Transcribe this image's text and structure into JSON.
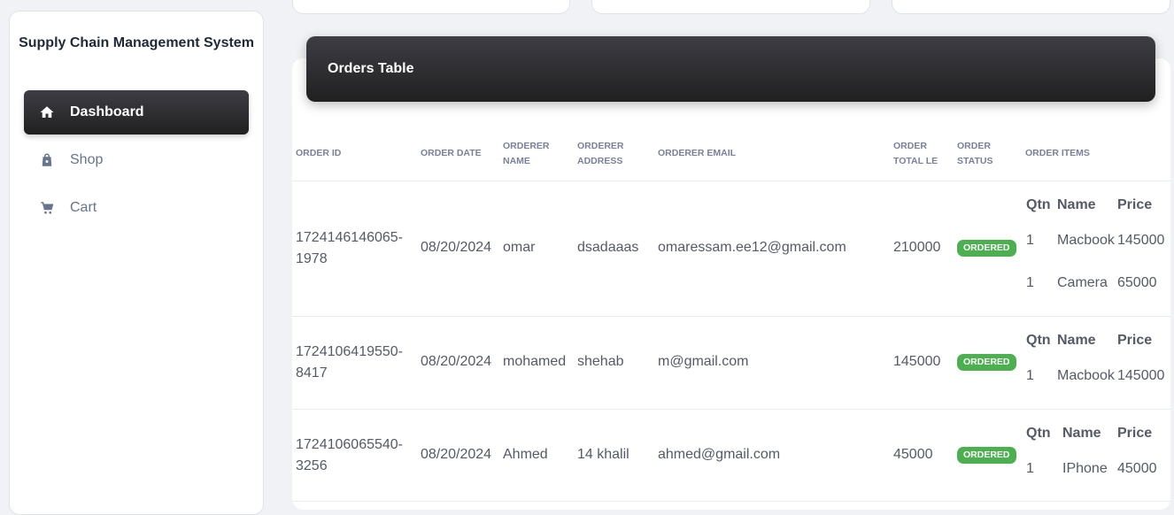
{
  "brand": {
    "title": "Supply Chain Management System"
  },
  "sidebar": {
    "items": [
      {
        "label": "Dashboard",
        "icon": "home-icon",
        "active": true
      },
      {
        "label": "Shop",
        "icon": "shopping-bag-icon",
        "active": false
      },
      {
        "label": "Cart",
        "icon": "cart-icon",
        "active": false
      }
    ]
  },
  "orders_table": {
    "title": "Orders Table",
    "columns": [
      "ORDER ID",
      "ORDER DATE",
      "ORDERER NAME",
      "ORDERER ADDRESS",
      "ORDERER EMAIL",
      "ORDER TOTAL LE",
      "ORDER STATUS",
      "ORDER ITEMS"
    ],
    "items_columns": [
      "Qtn",
      "Name",
      "Price"
    ],
    "rows": [
      {
        "order_id": "1724146146065-1978",
        "order_date": "08/20/2024",
        "name": "omar",
        "address": "dsadaaas",
        "email": "omaressam.ee12@gmail.com",
        "total": "210000",
        "status": "ORDERED",
        "items": [
          {
            "qtn": "1",
            "name": "Macbook",
            "price": "145000"
          },
          {
            "qtn": "1",
            "name": "Camera",
            "price": "65000"
          }
        ]
      },
      {
        "order_id": "1724106419550-8417",
        "order_date": "08/20/2024",
        "name": "mohamed",
        "address": "shehab",
        "email": "m@gmail.com",
        "total": "145000",
        "status": "ORDERED",
        "items": [
          {
            "qtn": "1",
            "name": "Macbook",
            "price": "145000"
          }
        ]
      },
      {
        "order_id": "1724106065540-3256",
        "order_date": "08/20/2024",
        "name": "Ahmed",
        "address": "14 khalil",
        "email": "ahmed@gmail.com",
        "total": "45000",
        "status": "ORDERED",
        "items": [
          {
            "qtn": "1",
            "name": "IPhone",
            "price": "45000"
          }
        ]
      }
    ]
  },
  "colors": {
    "status_ordered": "#4caf50",
    "header_dark": "#202020"
  }
}
